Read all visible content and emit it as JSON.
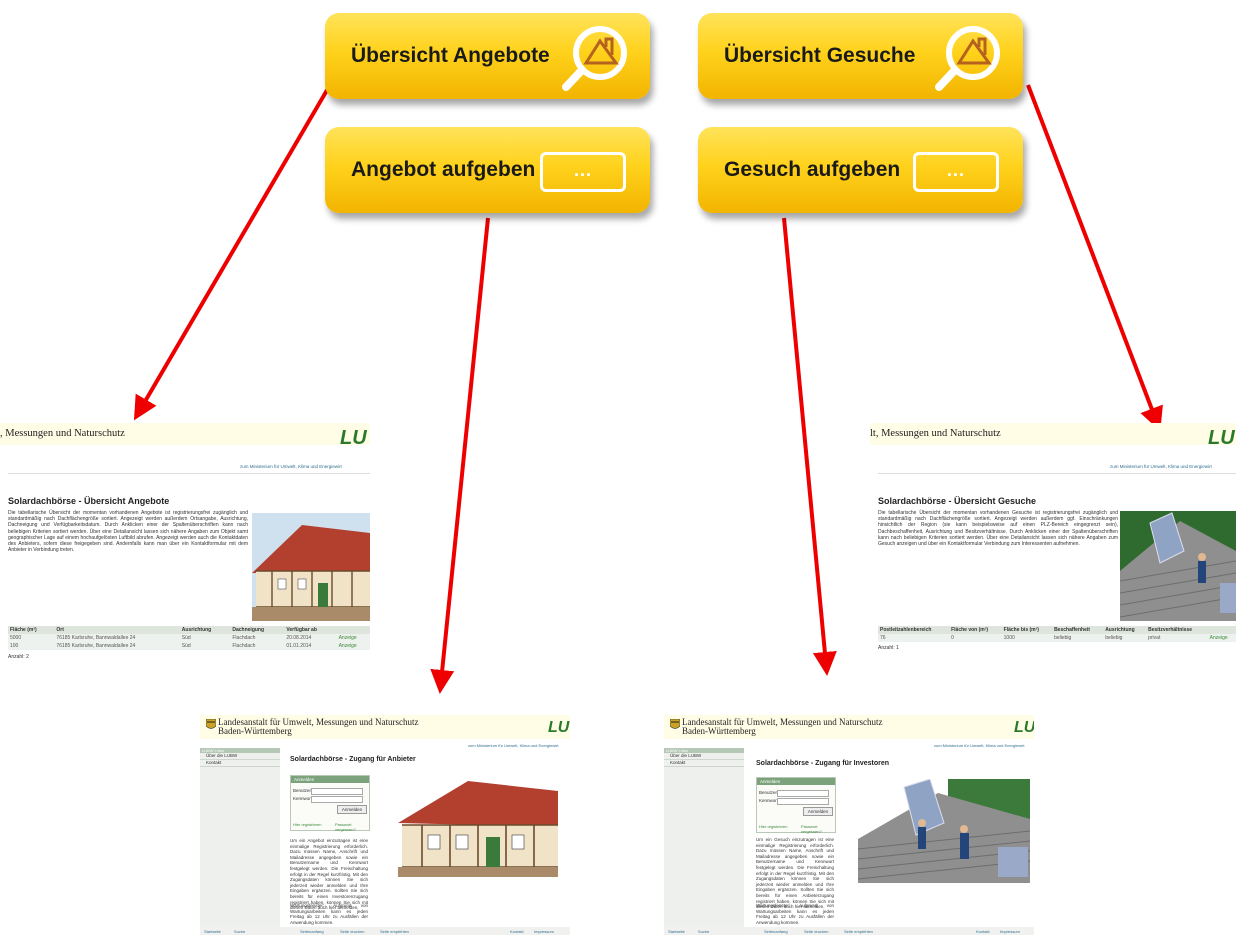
{
  "buttons": {
    "overview_offers": "Übersicht Angebote",
    "overview_requests": "Übersicht Gesuche",
    "post_offer": "Angebot aufgeben",
    "post_request": "Gesuch aufgeben",
    "dots": "..."
  },
  "colors": {
    "button": "#ffd21c",
    "arrow": "#ee0000",
    "brand_green": "#2a7a2a"
  },
  "icons": {
    "magnifier": "magnifier-house-icon",
    "form": "form-dots-icon"
  },
  "shot_offers": {
    "header": ", Messungen und Naturschutz",
    "logo": "LU",
    "ministry_link": "zum Ministerium für Umwelt, Klima und Energiewirt",
    "title": "Solardachbörse - Übersicht Angebote",
    "intro": "Die tabellarische Übersicht der momentan vorhandenen Angebote ist registrierungsfrei zugänglich und standardmäßig nach Dachflächengröße sortiert. Angezeigt werden außerdem Ortsangabe, Ausrichtung, Dachneigung und Verfügbarkeitsdatum. Durch Anklicken einer der Spaltenüberschriften kann nach beliebigen Kriterien sortiert werden. Über eine Detailansicht lassen sich nähere Angaben zum Objekt samt geographischer Lage auf einem hochaufgelösten Luftbild abrufen. Angezeigt werden auch die Kontaktdaten des Anbieters, sofern diese freigegeben sind. Andernfalls kann man über ein Kontaktformular mit dem Anbieter in Verbindung treten.",
    "columns": [
      "Fläche (m²)",
      "Ort",
      "Ausrichtung",
      "Dachneigung",
      "Verfügbar ab",
      ""
    ],
    "rows": [
      [
        "5000",
        "76185 Karlsruhe, Bannwaldallee 24",
        "Süd",
        "Flachdach",
        "20.08.2014",
        "Anzeige"
      ],
      [
        "100",
        "76185 Karlsruhe, Bannwaldallee 24",
        "Süd",
        "Flachdach",
        "01.01.2014",
        "Anzeige"
      ]
    ],
    "count": "Anzahl: 2"
  },
  "shot_requests": {
    "header": "lt, Messungen und Naturschutz",
    "logo": "LU",
    "ministry_link": "zum Ministerium für Umwelt, Klima und Energiewirt",
    "title": "Solardachbörse - Übersicht Gesuche",
    "intro": "Die tabellarische Übersicht der momentan vorhandenen Gesuche ist registrierungsfrei zugänglich und standardmäßig nach Dachflächengröße sortiert. Angezeigt werden außerdem ggf. Einschränkungen hinsichtlich der Region (sie kann beispielsweise auf einen PLZ-Bereich eingegrenzt sein), Dachbeschaffenheit, Ausrichtung und Besitzverhältnisse. Durch Anklicken einer der Spaltenüberschriften kann nach beliebigen Kriterien sortiert werden. Über eine Detailansicht lassen sich nähere Angaben zum Gesuch anzeigen und über ein Kontaktformular Verbindung zum Interessenten aufnehmen.",
    "columns": [
      "Postleitzahlenbereich",
      "Fläche von (m²)",
      "Fläche bis (m²)",
      "Beschaffenheit",
      "Ausrichtung",
      "Besitzverhältnisse",
      ""
    ],
    "rows": [
      [
        "76",
        "0",
        "1000",
        "beliebig",
        "beliebig",
        "privat",
        "Anzeige"
      ]
    ],
    "count": "Anzahl: 1"
  },
  "shot_login_provider": {
    "header1": "Landesanstalt für Umwelt, Messungen und Naturschutz",
    "header2": "Baden-Württemberg",
    "logo": "LU",
    "ministry_link": "zum Ministerium für Umwelt, Klima und Energiewirt",
    "sidebar_top": "LUBW Links",
    "sidebar": [
      "Über die LUBW",
      "Kontakt"
    ],
    "title": "Solardachbörse - Zugang für Anbieter",
    "box_title": "Anmelden",
    "user_label": "Benutzer:",
    "pass_label": "Kennwort:",
    "login_button": "Anmelden",
    "register": "Hier registrieren",
    "forgot": "Passwort vergessen?",
    "text": "Um ein Angebot einzutragen ist eine einmalige Registrierung erforderlich. Dazu müssen Name, Anschrift und Mailadresse angegeben sowie ein Benutzername und Kennwort festgelegt werden. Die Freischaltung erfolgt in der Regel kurzfristig. Mit den Zugangsdaten können Sie sich jederzeit wieder anmelden und Ihre Eingaben ergänzen. Sollten Sie sich bereits für einen Investorenzugang registriert haben, können Sie sich mit diesen Daten auch hier anmelden.",
    "maintenance": "Wartungsfenster: Aufgrund von Wartungsarbeiten kann es jeden Freitag ab 12 Uhr zu Ausfällen der Anwendung kommen.",
    "footer_left": [
      "Startseite",
      "Suche"
    ],
    "footer_mid": [
      "Seitenanfang",
      "Seite drucken",
      "Seite empfehlen"
    ],
    "footer_right": [
      "Kontakt",
      "Impressum"
    ]
  },
  "shot_login_investor": {
    "header1": "Landesanstalt für Umwelt, Messungen und Naturschutz",
    "header2": "Baden-Württemberg",
    "logo": "LU",
    "ministry_link": "zum Ministerium für Umwelt, Klima und Energiewirt",
    "sidebar_top": "LUBW Links",
    "sidebar": [
      "Über die LUBW",
      "Kontakt"
    ],
    "title": "Solardachbörse - Zugang für Investoren",
    "box_title": "Anmelden",
    "user_label": "Benutzer:",
    "pass_label": "Kennwort:",
    "login_button": "Anmelden",
    "register": "Hier registrieren",
    "forgot": "Passwort vergessen?",
    "text": "Um ein Gesuch einzutragen ist eine einmalige Registrierung erforderlich. Dazu müssen Name, Anschrift und Mailadresse angegeben sowie ein Benutzername und Kennwort festgelegt werden. Die Freischaltung erfolgt in der Regel kurzfristig. Mit den Zugangsdaten können Sie sich jederzeit wieder anmelden und Ihre Eingaben ergänzen. Sollten Sie sich bereits für einen Anbieterzugang registriert haben, können Sie sich mit diesen Daten auch hier anmelden.",
    "maintenance": "Wartungsfenster: Aufgrund von Wartungsarbeiten kann es jeden Freitag ab 12 Uhr zu Ausfällen der Anwendung kommen.",
    "footer_left": [
      "Startseite",
      "Suche"
    ],
    "footer_mid": [
      "Seitenanfang",
      "Seite drucken",
      "Seite empfehlen"
    ],
    "footer_right": [
      "Kontakt",
      "Impressum"
    ]
  }
}
